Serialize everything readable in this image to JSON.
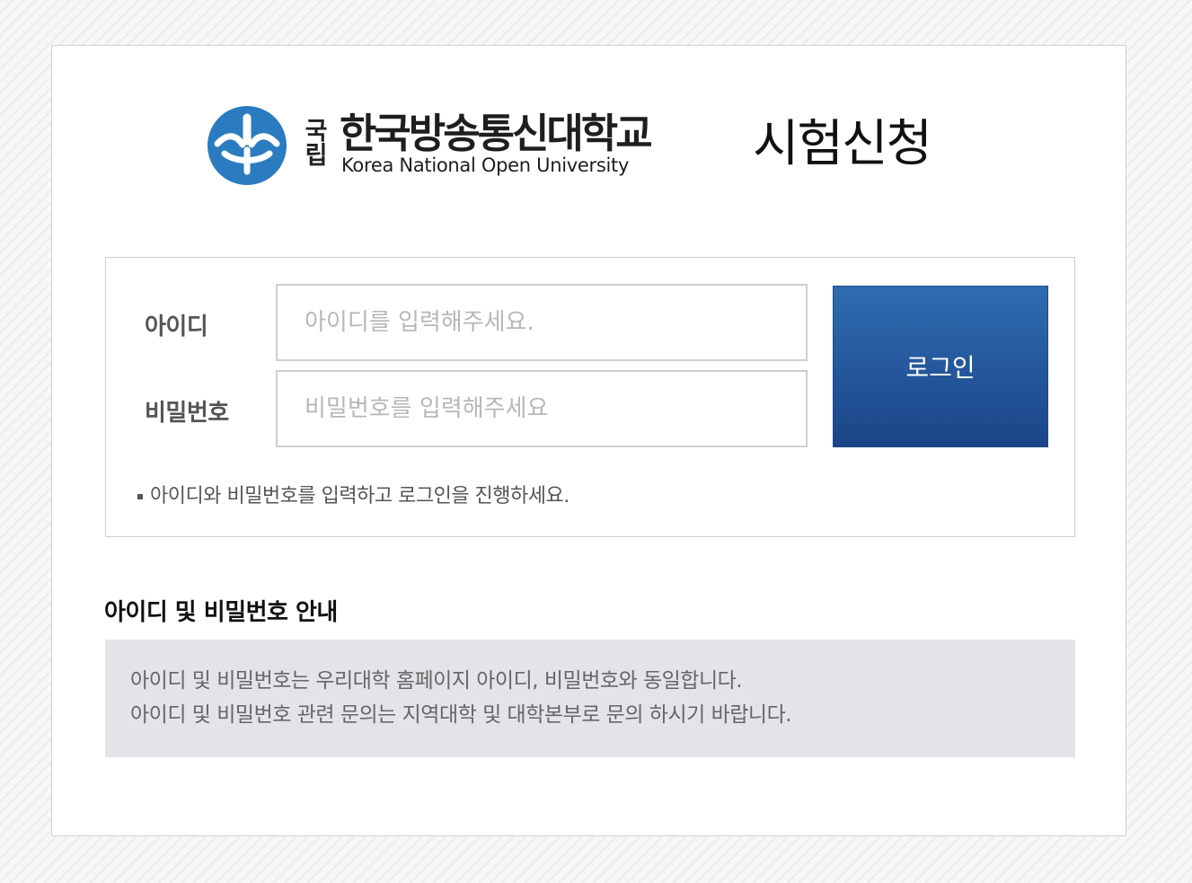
{
  "header": {
    "emblem_icon": "knou-emblem-icon",
    "name_prefix_top": "국",
    "name_prefix_bottom": "립",
    "university_name_ko": "한국방송통신대학교",
    "university_name_en": "Korea National Open University",
    "page_title": "시험신청"
  },
  "login": {
    "id_label": "아이디",
    "id_placeholder": "아이디를 입력해주세요.",
    "id_value": "",
    "pw_label": "비밀번호",
    "pw_placeholder": "비밀번호를 입력해주세요",
    "pw_value": "",
    "button_label": "로그인",
    "hint": "아이디와 비밀번호를 입력하고 로그인을 진행하세요."
  },
  "guide": {
    "title": "아이디 및 비밀번호 안내",
    "lines": [
      "아이디 및 비밀번호는 우리대학 홈페이지 아이디, 비밀번호와 동일합니다.",
      "아이디 및 비밀번호 관련 문의는 지역대학 및 대학본부로 문의 하시기 바랍니다."
    ]
  },
  "colors": {
    "button_top": "#2f6cb0",
    "button_bottom": "#1b4488",
    "emblem_blue": "#2b7bc0",
    "guide_bg": "#e3e4e8"
  }
}
